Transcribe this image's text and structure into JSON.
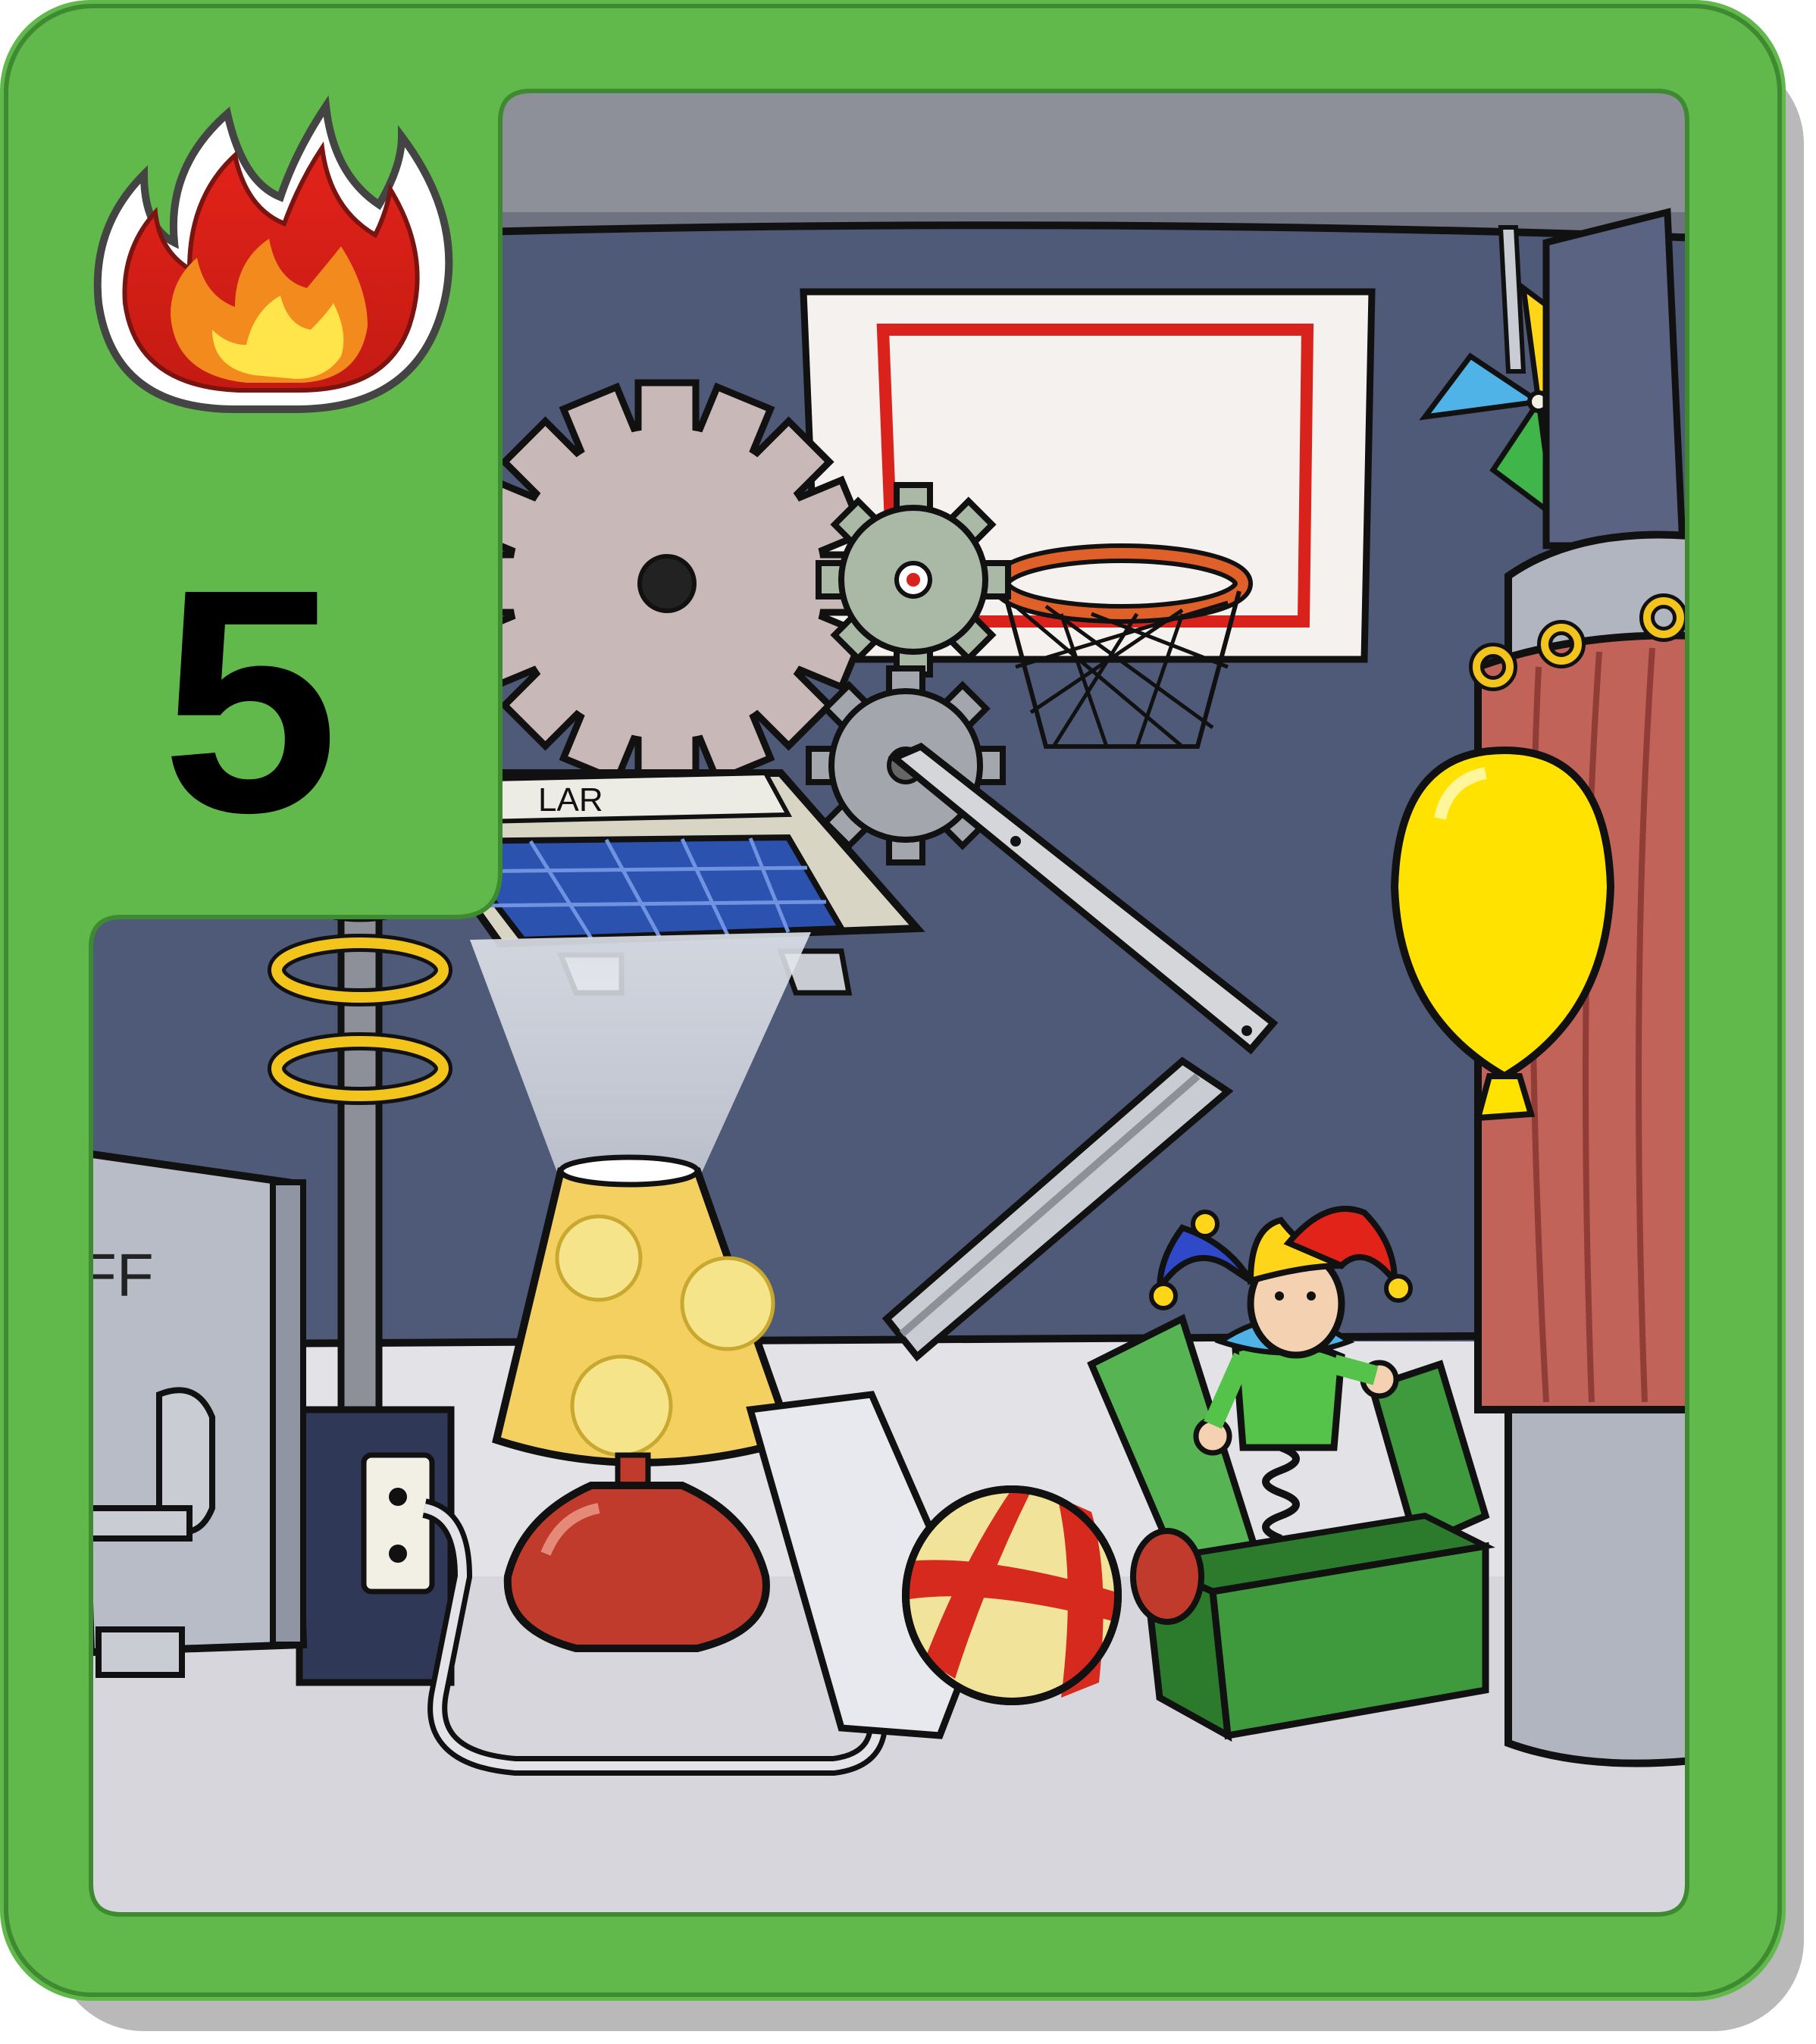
{
  "card": {
    "power_number": "5",
    "element": "fire",
    "element_icon": "fire-icon",
    "border_color": "#62b94b",
    "shadow_color": "#b9b9b9"
  },
  "scene": {
    "solar_panel_label": "LAR",
    "switch_label": "FF"
  },
  "colors": {
    "wall": "#4f5a78",
    "floor": "#e3e3e7",
    "ceiling": "#8d8f99",
    "balloon": "#ffe200",
    "toy_box": "#3f9a3d",
    "curtain": "#c2635a",
    "lamp_base": "#c03b2c"
  }
}
